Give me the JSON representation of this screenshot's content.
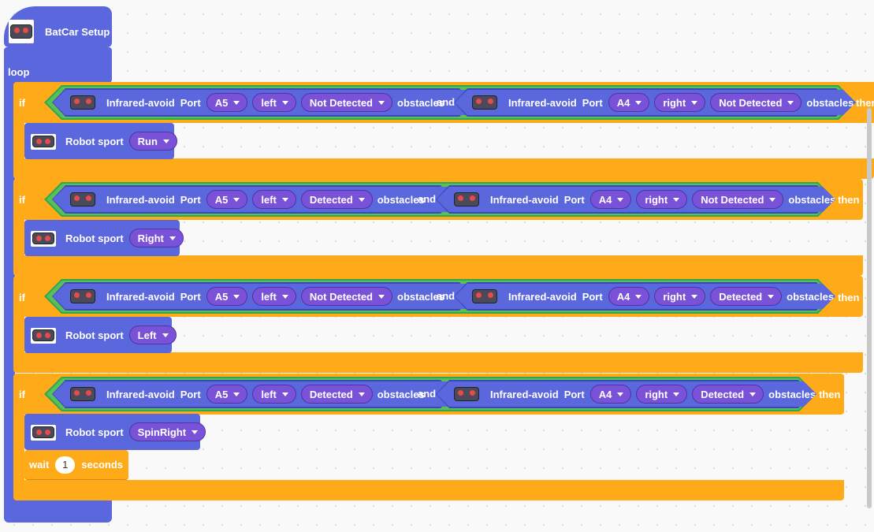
{
  "setup": {
    "label": "BatCar Setup"
  },
  "loop": {
    "label": "loop"
  },
  "if_blocks": [
    {
      "if_label": "if",
      "then_label": "then",
      "and_label": "and",
      "left": {
        "sensor": "Infrared-avoid",
        "port_label": "Port",
        "port": "A5",
        "side": "left",
        "state": "Not Detected",
        "suffix": "obstacles"
      },
      "right": {
        "sensor": "Infrared-avoid",
        "port_label": "Port",
        "port": "A4",
        "side": "right",
        "state": "Not Detected",
        "suffix": "obstacles"
      },
      "sport": {
        "label": "Robot sport",
        "value": "Run"
      }
    },
    {
      "if_label": "if",
      "then_label": "then",
      "and_label": "and",
      "left": {
        "sensor": "Infrared-avoid",
        "port_label": "Port",
        "port": "A5",
        "side": "left",
        "state": "Detected",
        "suffix": "obstacles"
      },
      "right": {
        "sensor": "Infrared-avoid",
        "port_label": "Port",
        "port": "A4",
        "side": "right",
        "state": "Not Detected",
        "suffix": "obstacles"
      },
      "sport": {
        "label": "Robot sport",
        "value": "Right"
      }
    },
    {
      "if_label": "if",
      "then_label": "then",
      "and_label": "and",
      "left": {
        "sensor": "Infrared-avoid",
        "port_label": "Port",
        "port": "A5",
        "side": "left",
        "state": "Not Detected",
        "suffix": "obstacles"
      },
      "right": {
        "sensor": "Infrared-avoid",
        "port_label": "Port",
        "port": "A4",
        "side": "right",
        "state": "Detected",
        "suffix": "obstacles"
      },
      "sport": {
        "label": "Robot sport",
        "value": "Left"
      }
    },
    {
      "if_label": "if",
      "then_label": "then",
      "and_label": "and",
      "left": {
        "sensor": "Infrared-avoid",
        "port_label": "Port",
        "port": "A5",
        "side": "left",
        "state": "Detected",
        "suffix": "obstacles"
      },
      "right": {
        "sensor": "Infrared-avoid",
        "port_label": "Port",
        "port": "A4",
        "side": "right",
        "state": "Detected",
        "suffix": "obstacles"
      },
      "sport": {
        "label": "Robot sport",
        "value": "SpinRight"
      }
    }
  ],
  "wait": {
    "label": "wait",
    "value": "1",
    "unit": "seconds"
  },
  "colors": {
    "motion_blue": "#5b67dd",
    "control_orange": "#ffab19",
    "operator_green": "#59c059",
    "menu_purple": "#7a52d8"
  }
}
